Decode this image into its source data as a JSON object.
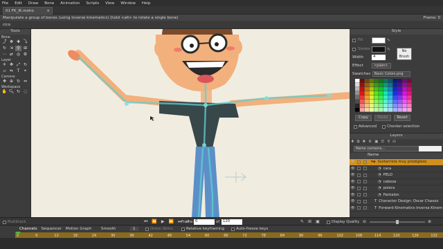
{
  "menu": [
    "File",
    "Edit",
    "Draw",
    "Bone",
    "Animation",
    "Scripts",
    "View",
    "Window",
    "Help"
  ],
  "tab": {
    "name": "01 FK_IK.moho",
    "close": "×"
  },
  "status": {
    "hint": "Manipulate a group of bones (using inverse kinematics) (hold <alt> to rotate a single bone)",
    "frame": "Frame: 0"
  },
  "breadcrumb": "cico",
  "tools": {
    "title": "Tools",
    "bone": "Bone",
    "layer": "Layer",
    "camera": "Camera",
    "workspace": "Workspace"
  },
  "style": {
    "title": "Style",
    "fill": "Fill",
    "stroke": "Stroke",
    "width_label": "Width",
    "width": "4",
    "effect_label": "Effect",
    "effect": "<plain>",
    "nobrush": "No Brush",
    "swatches_label": "Swatches",
    "swatches": "Basic Colors.png",
    "copy": "Copy",
    "paste": "Paste",
    "reset": "Reset",
    "advanced": "Advanced",
    "checker": "Checker selection"
  },
  "layers": {
    "title": "Layers",
    "filter": "Name contains...",
    "col_name": "Name",
    "rows": [
      {
        "name": "Guitarrista muy prodigioso",
        "indent": 0,
        "selected": true
      },
      {
        "name": "cara",
        "indent": 2
      },
      {
        "name": "PELO",
        "indent": 2
      },
      {
        "name": "cabeza",
        "indent": 2
      },
      {
        "name": "polera",
        "indent": 2
      },
      {
        "name": "Pantalon",
        "indent": 2
      },
      {
        "name": "Character Design: Oscar Chavez",
        "indent": 1
      },
      {
        "name": "Forward Kinematics Inversa Kinem",
        "indent": 1
      }
    ]
  },
  "playback": {
    "multitrack": "Multitrack",
    "frame_label": "Frame",
    "frame": "0",
    "of": "of",
    "total": "120",
    "quality": "Display Quality"
  },
  "timeline": {
    "tabs": [
      "Channels",
      "Sequencer",
      "Motion Graph"
    ],
    "smooth": "Smooth",
    "one": "1",
    "onion": "Onion Skins",
    "relative": "Relative keyframing",
    "autofreeze": "Auto-freeze keys",
    "ticks": [
      "0",
      "6",
      "12",
      "18",
      "24",
      "30",
      "36",
      "42",
      "48",
      "54",
      "60",
      "66",
      "72",
      "78",
      "84",
      "90",
      "96",
      "102",
      "108",
      "114",
      "120",
      "126",
      "132"
    ]
  },
  "colors": {
    "selected_layer": "#d1901c",
    "canvas": "#f1ece0",
    "ruler": "#8a6a1e"
  }
}
